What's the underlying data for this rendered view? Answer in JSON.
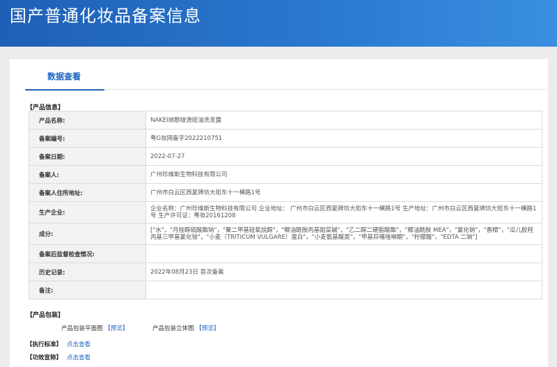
{
  "header": {
    "title": "国产普通化妆品备案信息"
  },
  "tab": {
    "label": "数据查看"
  },
  "product_info": {
    "section_label": "【产品信息】",
    "rows": [
      {
        "key": "产品名称:",
        "value": "NAKEI纳歌啵滑痘油洗发露"
      },
      {
        "key": "备案编号:",
        "value": "粤G妆网备字2022210751"
      },
      {
        "key": "备案日期:",
        "value": "2022-07-27"
      },
      {
        "key": "备案人:",
        "value": "广州珍维斯生物科技有限公司"
      },
      {
        "key": "备案人住所地址:",
        "value": "广州市白云区西夏牌坊大街东十一横路1号"
      },
      {
        "key": "生产企业:",
        "value": "企业名称：广州珍维斯生物科技有限公司 企业地址： 广州市白云区西夏牌坊大街东十一横路1号 生产地址：广州市白云区西夏牌坊大街东十一横路1号 生产许可证：粤妆20161208"
      },
      {
        "key": "成分:",
        "value": "[\"水\"，\"月桂醇硫酸酯钠\"，\"聚二甲基硅氧烷醇\"，\"椰油酰胺丙基甜菜碱\"，\"乙二醇二硬脂酸酯\"，\"椰油酰胺 MEA\"，\"氯化钠\"，\"香精\"，\"瓜儿胶羟丙基三甲基氯化铵\"，\"小麦（TRITICUM VULGARE）蛋白\"，\"小麦氨基酸类\"，\"甲基异噻唑啉酮\"，\"柠檬酸\"，\"EDTA 二钠\"]"
      },
      {
        "key": "备案后监督检查情况:",
        "value": ""
      },
      {
        "key": "历史记录:",
        "value": "2022年08月23日 首次备案"
      },
      {
        "key": "备注:",
        "value": ""
      }
    ]
  },
  "packaging": {
    "section_label": "【产品包装】",
    "flat_label": "产品包装平面图",
    "flat_link": "【预览】",
    "solid_label": "产品包装立体图",
    "solid_link": "【预览】"
  },
  "standard": {
    "label": "【执行标准】",
    "link": "点击查看"
  },
  "efficacy": {
    "label": "【功效宣称】",
    "link": "点击查看"
  }
}
